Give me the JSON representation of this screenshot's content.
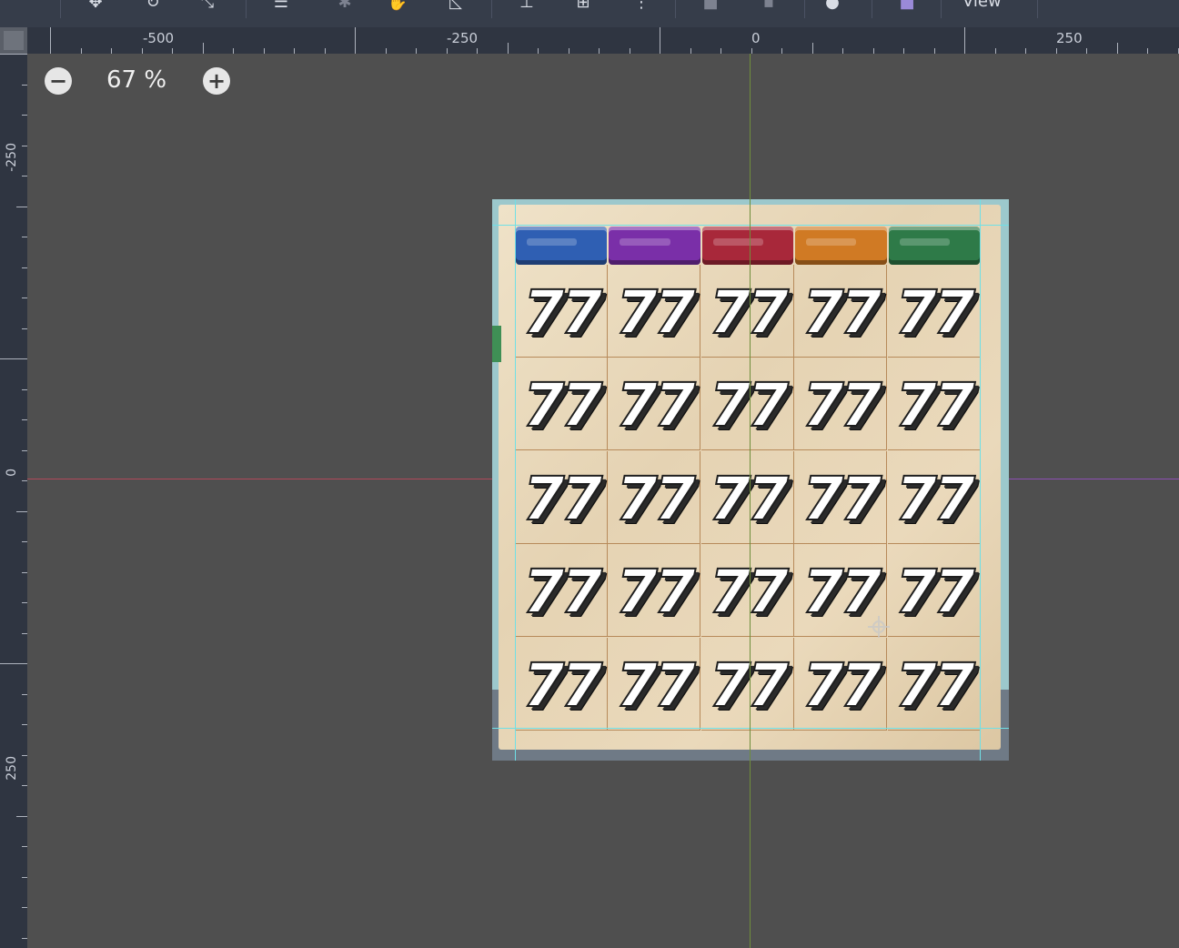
{
  "toolbar": {
    "view_menu_label": "View",
    "icons": [
      "select-tool-icon",
      "move-tool-icon",
      "rotate-tool-icon",
      "scale-tool-icon",
      "list-select-icon",
      "pick-icon",
      "pan-icon",
      "ruler-icon",
      "snap-grid-icon",
      "snap-options-icon",
      "more-icon",
      "lock-icon",
      "group-icon",
      "skeleton-icon",
      "camera-icon"
    ]
  },
  "rulers": {
    "horizontal_labels": [
      "-500",
      "-250",
      "0",
      "250"
    ],
    "vertical_labels": [
      "-250",
      "0",
      "250"
    ]
  },
  "zoom": {
    "level": "67 %",
    "zoom_out_symbol": "−",
    "zoom_in_symbol": "+"
  },
  "board": {
    "header_gems": [
      {
        "name": "blue",
        "color": "#2f5fb3"
      },
      {
        "name": "purple",
        "color": "#7a2fa8"
      },
      {
        "name": "red",
        "color": "#a8283a"
      },
      {
        "name": "orange",
        "color": "#d07a24"
      },
      {
        "name": "green",
        "color": "#2e7a48"
      }
    ],
    "rows": 5,
    "cols": 5,
    "cell_symbol": "77"
  },
  "colors": {
    "canvas_bg": "#4f4f4f",
    "ruler_bg": "#2f3541",
    "guide": "#6fe0e6",
    "x_axis": "#b0495a",
    "y_axis": "#6f8e3c"
  }
}
